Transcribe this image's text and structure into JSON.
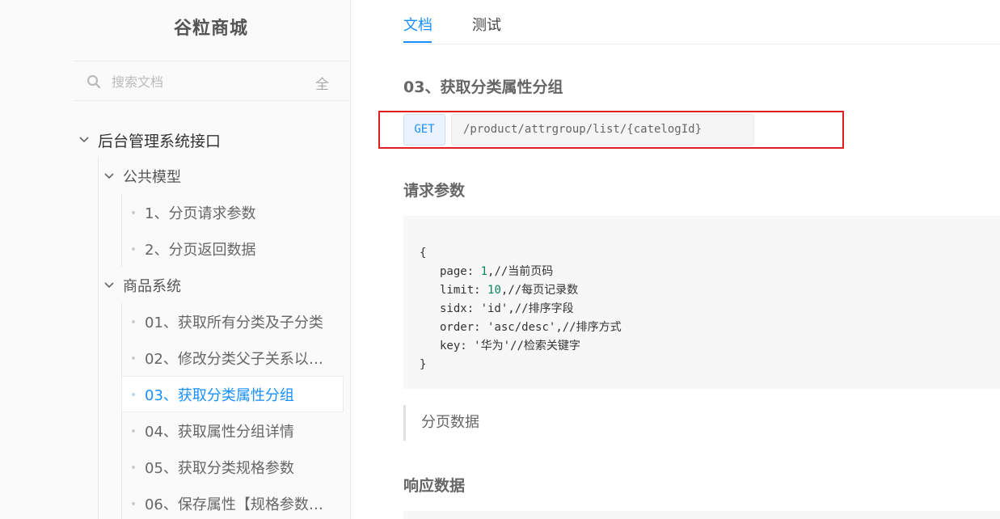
{
  "app": {
    "title": "谷粒商城"
  },
  "search": {
    "placeholder": "搜索文档",
    "scope_label": "全"
  },
  "tree": {
    "root": {
      "label": "后台管理系统接口"
    },
    "groups": [
      {
        "label": "公共模型",
        "items": [
          "1、分页请求参数",
          "2、分页返回数据"
        ]
      },
      {
        "label": "商品系统",
        "items": [
          "01、获取所有分类及子分类",
          "02、修改分类父子关系以及...",
          "03、获取分类属性分组",
          "04、获取属性分组详情",
          "05、获取分类规格参数",
          "06、保存属性【规格参数，..."
        ]
      }
    ],
    "active_item": "03、获取分类属性分组"
  },
  "tabs": [
    {
      "label": "文档",
      "active": true
    },
    {
      "label": "测试",
      "active": false
    }
  ],
  "doc": {
    "title": "03、获取分类属性分组",
    "method": "GET",
    "url": "/product/attrgroup/list/{catelogId}",
    "request_params_title": "请求参数",
    "code": {
      "open": "{",
      "lines": [
        {
          "key": "page",
          "value": "1",
          "comment": "//当前页码"
        },
        {
          "key": "limit",
          "value": "10",
          "comment": "//每页记录数"
        },
        {
          "key": "sidx",
          "value": "'id'",
          "comment": "//排序字段"
        },
        {
          "key": "order",
          "value": "'asc/desc'",
          "comment": "//排序方式"
        },
        {
          "key": "key",
          "value": "'华为'",
          "comment": "//检索关键字"
        }
      ],
      "close": "}"
    },
    "note": "分页数据",
    "response_title": "响应数据"
  },
  "colors": {
    "accent": "#1890ff",
    "highlight": "#e02020"
  },
  "icons": {
    "search": "search-icon",
    "chevron": "chevron-down-icon"
  }
}
